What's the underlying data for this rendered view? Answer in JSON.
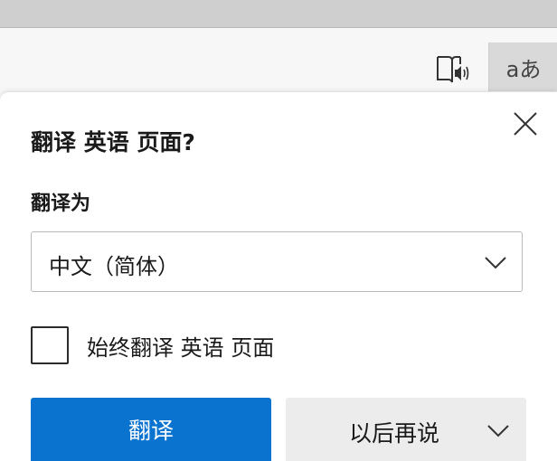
{
  "toolbar": {
    "read_aloud_icon": "read-aloud-icon",
    "translate_icon_glyph": "aあ",
    "translate_icon": "translate-icon"
  },
  "dialog": {
    "title": "翻译 英语 页面?",
    "translate_to_label": "翻译为",
    "language_select": {
      "value": "中文（简体）",
      "icon": "chevron-down-icon"
    },
    "always_translate_label": "始终翻译 英语 页面",
    "always_translate_checked": false,
    "translate_button": "翻译",
    "later_button": "以后再说",
    "close_icon": "close-icon"
  },
  "colors": {
    "primary": "#0a73d0",
    "secondary_button": "#ececec",
    "toolbar_active": "#d9d9d9"
  }
}
